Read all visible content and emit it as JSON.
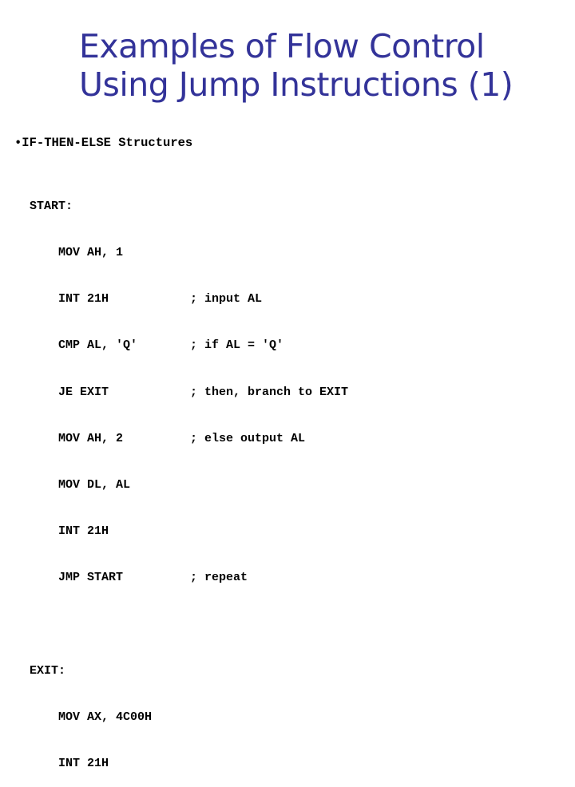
{
  "slide": {
    "title_lines": [
      "Examples of Flow Control",
      "Using Jump Instructions (1)"
    ],
    "bullet": "•IF-THEN-ELSE Structures",
    "code_left": [
      "START:",
      "    MOV AH, 1",
      "    INT 21H",
      "    CMP AL, 'Q'",
      "    JE EXIT",
      "    MOV AH, 2",
      "    MOV DL, AL",
      "    INT 21H",
      "    JMP START",
      "",
      "EXIT:",
      "    MOV AX, 4C00H",
      "    INT 21H"
    ],
    "comments": [
      "",
      "",
      "; input AL",
      "; if AL = 'Q'",
      "; then, branch to EXIT",
      "; else output AL",
      "",
      "",
      "; repeat"
    ],
    "colors": {
      "title": "#333399",
      "text": "#000000",
      "background": "#ffffff"
    }
  }
}
